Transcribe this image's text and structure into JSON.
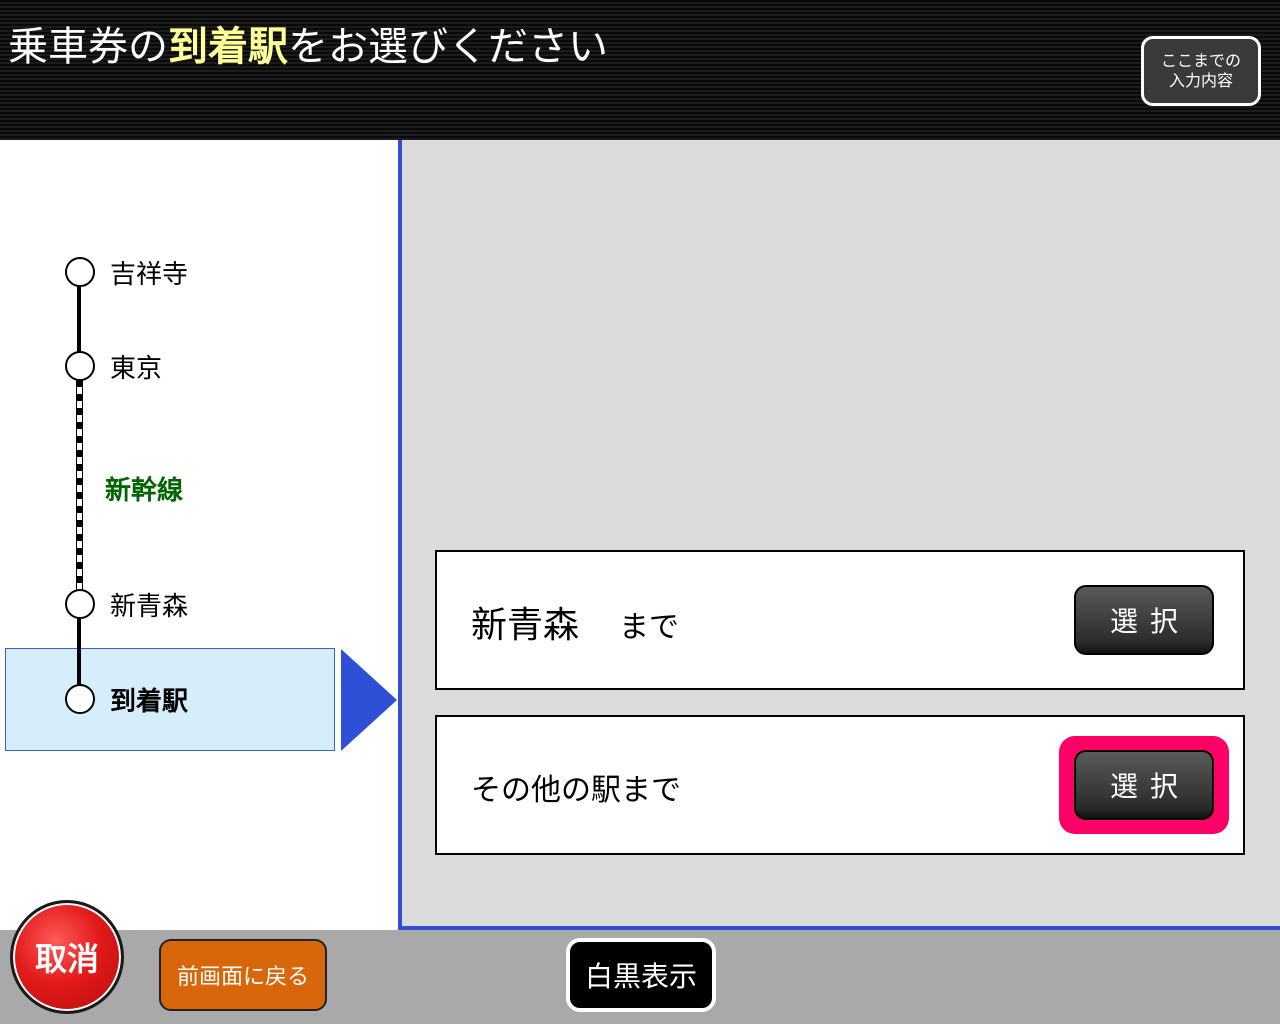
{
  "header": {
    "title_prefix": "乗車券の",
    "title_highlight": "到着駅",
    "title_suffix": "をお選びください",
    "summary_button": {
      "line1": "ここまでの",
      "line2": "入力内容"
    }
  },
  "route": {
    "stations": [
      {
        "label": "吉祥寺"
      },
      {
        "label": "東京"
      },
      {
        "label": "新青森"
      },
      {
        "label": "到着駅"
      }
    ],
    "line_label": "新幹線",
    "line_label_color": "#006400",
    "current_highlight_color": "#d6eefc"
  },
  "options": [
    {
      "station": "新青森",
      "suffix": "まで",
      "button": "選択"
    },
    {
      "text": "その他の駅まで",
      "button": "選択",
      "highlighted": true
    }
  ],
  "footer": {
    "cancel": "取消",
    "back": "前画面に戻る",
    "monochrome": "白黒表示"
  },
  "colors": {
    "accent_blue": "#2e4fd6",
    "highlight_pink": "#ff0066",
    "cancel_red": "#e21a1a",
    "back_orange": "#d8660a",
    "title_highlight": "#ffff99"
  }
}
